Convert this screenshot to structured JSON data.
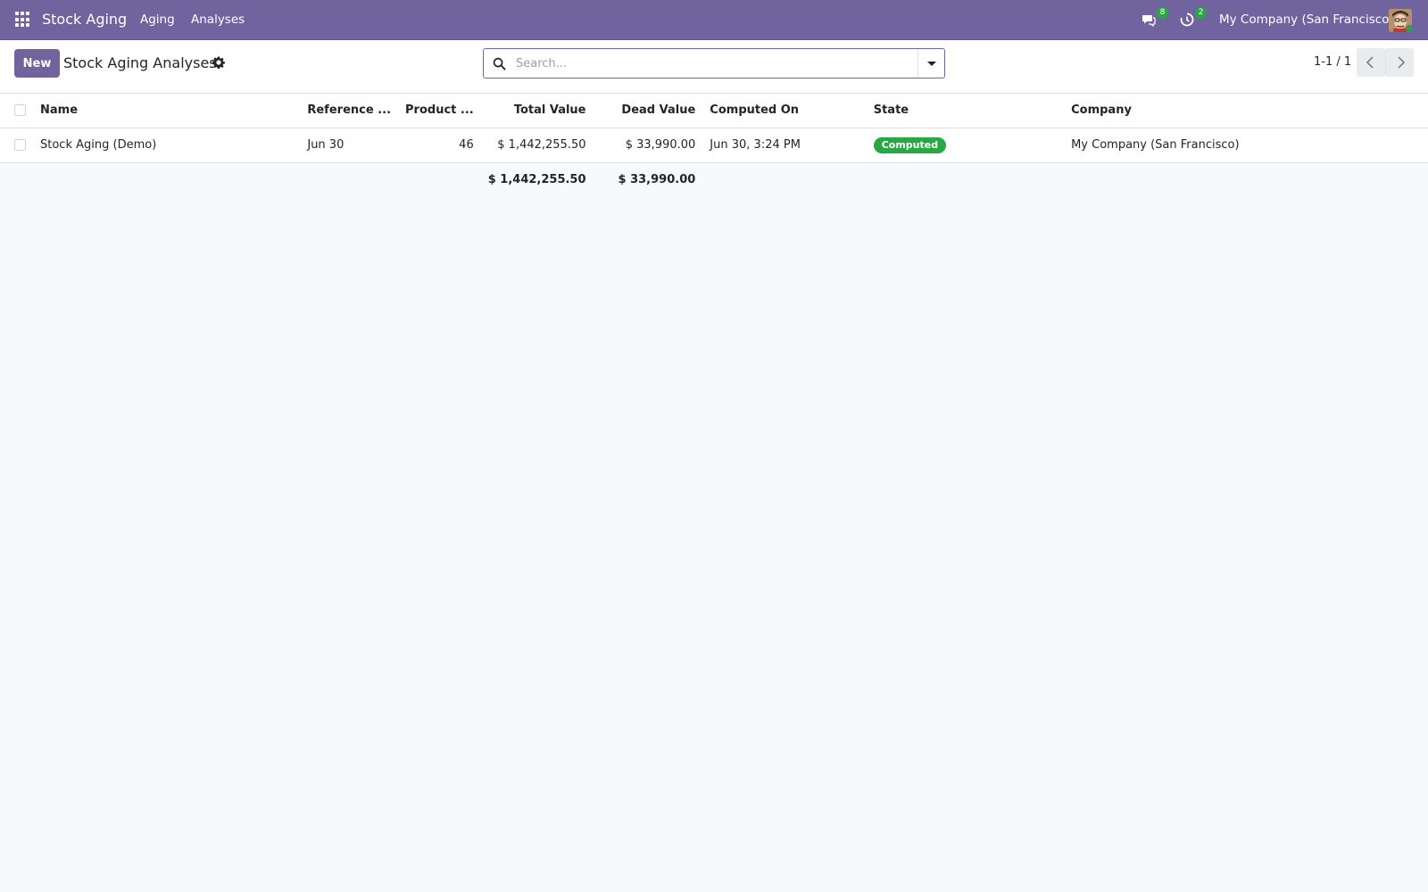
{
  "navbar": {
    "app_title": "Stock Aging",
    "menus": [
      "Aging",
      "Analyses"
    ],
    "messages_count": "8",
    "activities_count": "2",
    "company": "My Company (San Francisco)"
  },
  "control_panel": {
    "new_label": "New",
    "title": "Stock Aging Analyses",
    "search_placeholder": "Search...",
    "pager": "1-1 / 1"
  },
  "table": {
    "columns": [
      "Name",
      "Reference ...",
      "Product ...",
      "Total Value",
      "Dead Value",
      "Computed On",
      "State",
      "Company"
    ],
    "rows": [
      {
        "name": "Stock Aging (Demo)",
        "reference": "Jun 30",
        "product": "46",
        "total_value": "$ 1,442,255.50",
        "dead_value": "$ 33,990.00",
        "computed_on": "Jun 30, 3:24 PM",
        "state": "Computed",
        "company": "My Company (San Francisco)"
      }
    ],
    "totals": {
      "total_value": "$ 1,442,255.50",
      "dead_value": "$ 33,990.00"
    }
  },
  "colors": {
    "brand": "#71639e",
    "success": "#28a745"
  }
}
